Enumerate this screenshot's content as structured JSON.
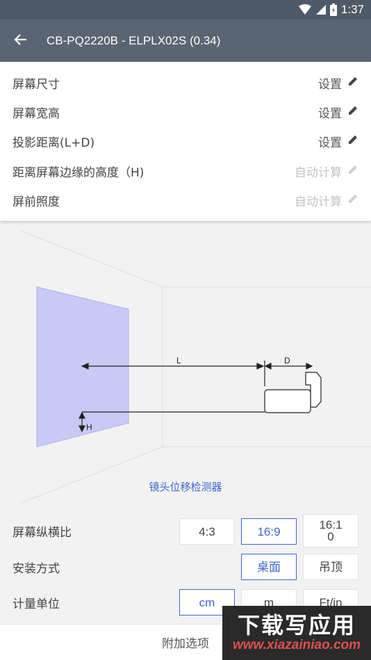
{
  "status_bar": {
    "time": "1:37",
    "icons": [
      "wifi-icon",
      "signal-icon",
      "battery-icon"
    ]
  },
  "app_bar": {
    "title": "CB-PQ2220B - ELPLX02S (0.34)",
    "back_icon": "arrow-left-icon"
  },
  "settings": [
    {
      "label": "屏幕尺寸",
      "action": "设置",
      "enabled": true
    },
    {
      "label": "屏幕宽高",
      "action": "设置",
      "enabled": true
    },
    {
      "label": "投影距离(L+D)",
      "action": "设置",
      "enabled": true
    },
    {
      "label": "距离屏幕边缘的高度（H)",
      "action": "自动计算",
      "enabled": false
    },
    {
      "label": "屏前照度",
      "action": "自动计算",
      "enabled": false
    }
  ],
  "diagram": {
    "label_l": "L",
    "label_d": "D",
    "label_h": "H"
  },
  "lens_shift_link": "镜头位移检测器",
  "aspect": {
    "label": "屏幕纵横比",
    "options": [
      "4:3",
      "16:9",
      "16:1\n0"
    ],
    "selected": "16:9"
  },
  "mount": {
    "label": "安装方式",
    "options": [
      "桌面",
      "吊顶"
    ],
    "selected": "桌面"
  },
  "unit": {
    "label": "计量单位",
    "options": [
      "cm",
      "m",
      "Ft/in"
    ],
    "selected": "cm"
  },
  "bottom_bar": {
    "label": "附加选项"
  },
  "watermark": {
    "title": "下载写应用",
    "url": "www.xiazainiao.com"
  },
  "colors": {
    "app_bar": "#5a6573",
    "status_bar": "#4f5a68",
    "accent": "#3f67cf",
    "screen_fill": "#c9c9f6"
  }
}
